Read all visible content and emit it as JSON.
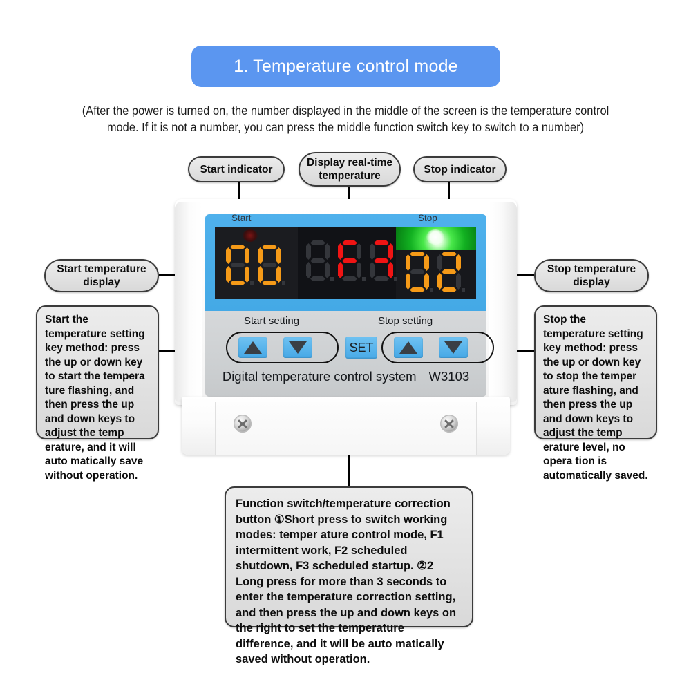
{
  "header": {
    "title": "1. Temperature control mode",
    "accent_color": "#5b96f0"
  },
  "subtitle": {
    "line1": "(After the power is turned on, the number displayed in the middle of the screen is the temperature control",
    "line2": "mode. If it is not a number, you can press the middle function switch key to switch to a number)"
  },
  "callouts": {
    "start_indicator": "Start indicator",
    "display_realtime": "Display real-time\ntemperature",
    "stop_indicator": "Stop indicator",
    "start_temperature_display": "Start temperature\ndisplay",
    "stop_temperature_display": "Stop temperature\ndisplay",
    "start_key_method": "Start the temperature setting key method: press the up or down key to start the tempera ture flashing, and then press the up and down keys to adjust the temp erature, and it will auto matically save without operation.",
    "stop_key_method": "Stop the temperature setting key method: press the up or down key to stop the temper ature flashing, and then press the up and down keys to adjust the temp erature level, no opera tion is automatically saved.",
    "function_switch": "Function switch/temperature correction button ①Short press to switch working modes: temper ature control mode, F1 intermittent work, F2 scheduled shutdown, F3 scheduled startup. ②2 Long press for more than 3 seconds to enter the temperature correction setting, and then press the up and down keys on the right to set the temperature difference, and it will be auto matically saved without operation."
  },
  "device": {
    "bezel_label_start": "Start",
    "bezel_label_stop": "Stop",
    "brand_text": "Digital temperature control system",
    "model": "W3103",
    "start_setting_label": "Start setting",
    "stop_setting_label": "Stop setting",
    "set_button_label": "SET",
    "up_arrow_icon": "triangle-up-icon",
    "down_arrow_icon": "triangle-down-icon",
    "bezel_color": "#4fb1ec",
    "panel_color": "#d0d3d5",
    "display": {
      "start_value": "00",
      "start_value_color": "#f59a18",
      "middle_value": "F3",
      "middle_value_color": "#f01414",
      "middle_leading_blank": true,
      "stop_value": "02",
      "stop_value_color": "#f59a18",
      "start_led_color": "#7a1515",
      "stop_led_color": "#2fd43a",
      "start_led_state": "off",
      "stop_led_state": "on"
    }
  }
}
